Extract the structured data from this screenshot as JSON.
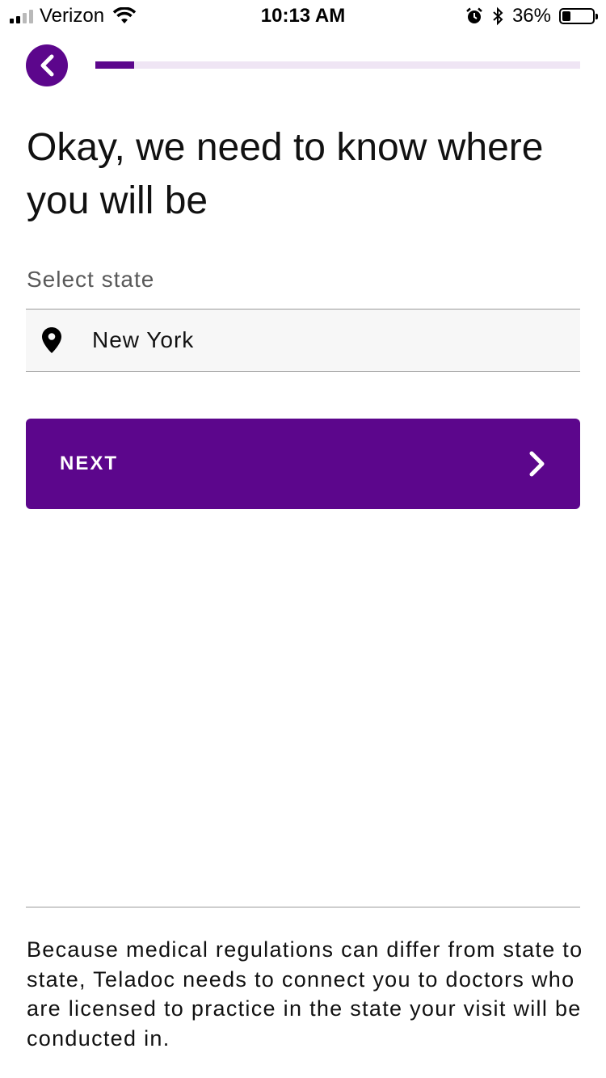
{
  "status_bar": {
    "carrier": "Verizon",
    "time": "10:13 AM",
    "battery_percent": "36%",
    "battery_level": 0.36,
    "icons": [
      "signal-icon",
      "wifi-icon",
      "alarm-icon",
      "bluetooth-icon",
      "battery-icon"
    ]
  },
  "header": {
    "back_icon": "chevron-left-icon",
    "progress_fraction": 0.08
  },
  "main": {
    "title": "Okay, we need to know where you will be",
    "state_label": "Select state",
    "state_value": "New York",
    "state_icon": "location-pin-icon",
    "next_label": "NEXT",
    "next_icon": "chevron-right-icon"
  },
  "footer": {
    "disclaimer": "Because medical regulations can differ from state to state, Teladoc needs to connect you to doctors who are licensed to practice in the state your visit will be conducted in."
  },
  "colors": {
    "brand_purple": "#5c068c",
    "progress_track": "#efe5f4",
    "field_background": "#f7f7f7"
  }
}
